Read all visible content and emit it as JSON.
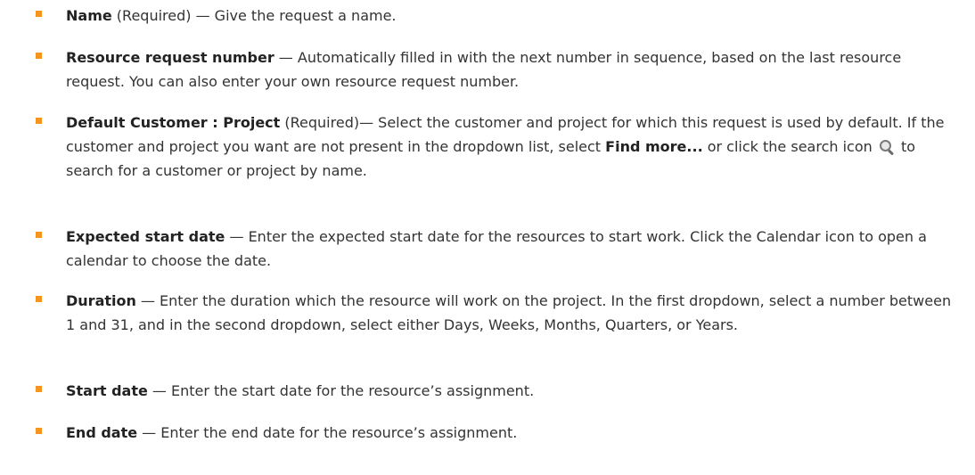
{
  "items": [
    {
      "term": "Name",
      "qualifier": " (Required)",
      "desc": " — Give the request a name."
    },
    {
      "term": "Resource request number",
      "desc": " — Automatically filled in with the next number in sequence, based on the last resource request. You can also enter your own resource request number."
    },
    {
      "term": "Default Customer : Project",
      "qualifier": " (Required)",
      "desc_before": "— Select the customer and project for which this request is used by default. If the customer and project you want are not present in the dropdown list, select ",
      "link_text": "Find more...",
      "desc_mid": " or click the search icon ",
      "icon": "search-icon",
      "desc_after": " to search for a customer or project by name."
    },
    {
      "term": "Expected start date",
      "desc": " — Enter the expected start date for the resources to start work. Click the Calendar icon to open a calendar to choose the date."
    },
    {
      "term": "Duration",
      "desc": " — Enter the duration which the resource will work on the project. In the first dropdown, select a number between 1 and 31, and in the second dropdown, select either Days, Weeks, Months, Quarters, or Years."
    },
    {
      "term": "Start date",
      "desc": " — Enter the start date for the resource’s assignment."
    },
    {
      "term": "End date",
      "desc": " — Enter the end date for the resource’s assignment."
    }
  ],
  "colors": {
    "bullet": "#f7941d",
    "text": "#333333"
  }
}
